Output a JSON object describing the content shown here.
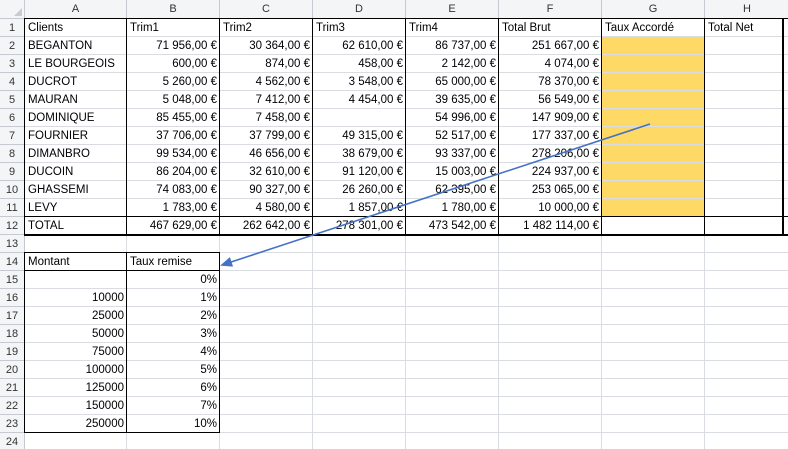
{
  "columns": [
    "A",
    "B",
    "C",
    "D",
    "E",
    "F",
    "G",
    "H"
  ],
  "rows": [
    "1",
    "2",
    "3",
    "4",
    "5",
    "6",
    "7",
    "8",
    "9",
    "10",
    "11",
    "12",
    "13",
    "14",
    "15",
    "16",
    "17",
    "18",
    "19",
    "20",
    "21",
    "22",
    "23",
    "24"
  ],
  "headers": [
    "Clients",
    "Trim1",
    "Trim2",
    "Trim3",
    "Trim4",
    "Total Brut",
    "Taux Accordé",
    "Total Net"
  ],
  "clients": [
    [
      "BEGANTON",
      "71 956,00 €",
      "30 364,00 €",
      "62 610,00 €",
      "86 737,00 €",
      "251 667,00 €"
    ],
    [
      "LE BOURGEOIS",
      "600,00 €",
      "874,00 €",
      "458,00 €",
      "2 142,00 €",
      "4 074,00 €"
    ],
    [
      "DUCROT",
      "5 260,00 €",
      "4 562,00 €",
      "3 548,00 €",
      "65 000,00 €",
      "78 370,00 €"
    ],
    [
      "MAURAN",
      "5 048,00 €",
      "7 412,00 €",
      "4 454,00 €",
      "39 635,00 €",
      "56 549,00 €"
    ],
    [
      "DOMINIQUE",
      "85 455,00 €",
      "7 458,00 €",
      "",
      "54 996,00 €",
      "147 909,00 €"
    ],
    [
      "FOURNIER",
      "37 706,00 €",
      "37 799,00 €",
      "49 315,00 €",
      "52 517,00 €",
      "177 337,00 €"
    ],
    [
      "DIMANBRO",
      "99 534,00 €",
      "46 656,00 €",
      "38 679,00 €",
      "93 337,00 €",
      "278 206,00 €"
    ],
    [
      "DUCOIN",
      "86 204,00 €",
      "32 610,00 €",
      "91 120,00 €",
      "15 003,00 €",
      "224 937,00 €"
    ],
    [
      "GHASSEMI",
      "74 083,00 €",
      "90 327,00 €",
      "26 260,00 €",
      "62 395,00 €",
      "253 065,00 €"
    ],
    [
      "LEVY",
      "1 783,00 €",
      "4 580,00 €",
      "1 857,00 €",
      "1 780,00 €",
      "10 000,00 €"
    ]
  ],
  "total_row": [
    "TOTAL",
    "467 629,00 €",
    "262 642,00 €",
    "278 301,00 €",
    "473 542,00 €",
    "1 482 114,00 €"
  ],
  "remise_headers": [
    "Montant",
    "Taux remise"
  ],
  "remise": [
    [
      "",
      "0%"
    ],
    [
      "10000",
      "1%"
    ],
    [
      "25000",
      "2%"
    ],
    [
      "50000",
      "3%"
    ],
    [
      "75000",
      "4%"
    ],
    [
      "100000",
      "5%"
    ],
    [
      "125000",
      "6%"
    ],
    [
      "150000",
      "7%"
    ],
    [
      "250000",
      "10%"
    ]
  ],
  "colors": {
    "highlight": "#ffd966",
    "arrow": "#4472c4",
    "header_bg": "#f4f5f7",
    "grid": "#d9dce0"
  }
}
